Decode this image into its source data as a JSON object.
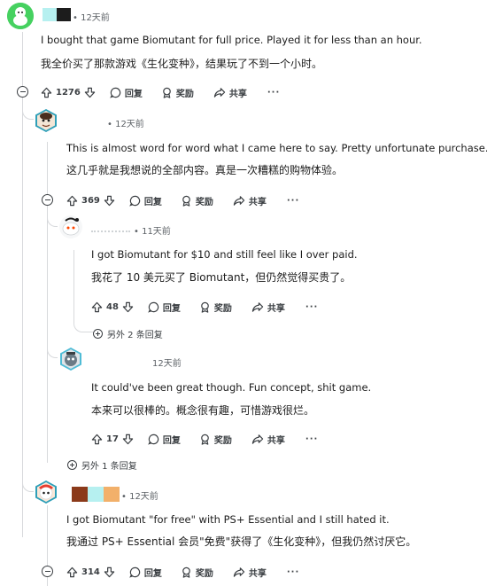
{
  "comments": [
    {
      "time": "• 12天前",
      "text_en": "I bought that game Biomutant for full price. Played it for less than an hour.",
      "text_cn": "我全价买了那款游戏《生化变种》，结果玩了不到一个小时。",
      "votes": "1276",
      "reply_label": "回复",
      "award_label": "奖励",
      "share_label": "共享",
      "more_label": "···"
    },
    {
      "time": "• 12天前",
      "text_en": "This is almost word for word what I came here to say. Pretty unfortunate purchase.",
      "text_cn": "这几乎就是我想说的全部内容。真是一次糟糕的购物体验。",
      "votes": "369",
      "reply_label": "回复",
      "award_label": "奖励",
      "share_label": "共享",
      "more_label": "···"
    },
    {
      "time": "• 11天前",
      "text_en": "I got Biomutant for $10 and still feel like I over paid.",
      "text_cn": "我花了 10 美元买了 Biomutant，但仍然觉得买贵了。",
      "votes": "48",
      "reply_label": "回复",
      "award_label": "奖励",
      "share_label": "共享",
      "more_label": "···"
    },
    {
      "time": "12天前",
      "text_en": "It could've been great though. Fun concept, shit game.",
      "text_cn": "本来可以很棒的。概念很有趣，可惜游戏很烂。",
      "votes": "17",
      "reply_label": "回复",
      "award_label": "奖励",
      "share_label": "共享",
      "more_label": "···"
    },
    {
      "time": "• 12天前",
      "text_en": "I got Biomutant \"for free\" with PS+ Essential and I still hated it.",
      "text_cn": "我通过 PS+ Essential 会员\"免费\"获得了《生化变种》，但我仍然讨厌它。",
      "votes": "314",
      "reply_label": "回复",
      "award_label": "奖励",
      "share_label": "共享",
      "more_label": "···"
    }
  ],
  "more_replies": [
    {
      "label": "另外 2 条回复"
    },
    {
      "label": "另外 1 条回复"
    }
  ],
  "colors": {
    "thread_line": "#d7d9dc",
    "meta": "#5c6166",
    "text": "#1c1c1c",
    "avatar1_bg": "#46d160",
    "redact_cyan": "#b6f0f0",
    "redact_black": "#1c1c1c",
    "redact_brown": "#8b3a1a",
    "redact_orange": "#f2b06a"
  },
  "icons": [
    "upvote-icon",
    "downvote-icon",
    "comment-icon",
    "award-icon",
    "share-icon",
    "collapse-icon",
    "expand-icon"
  ]
}
